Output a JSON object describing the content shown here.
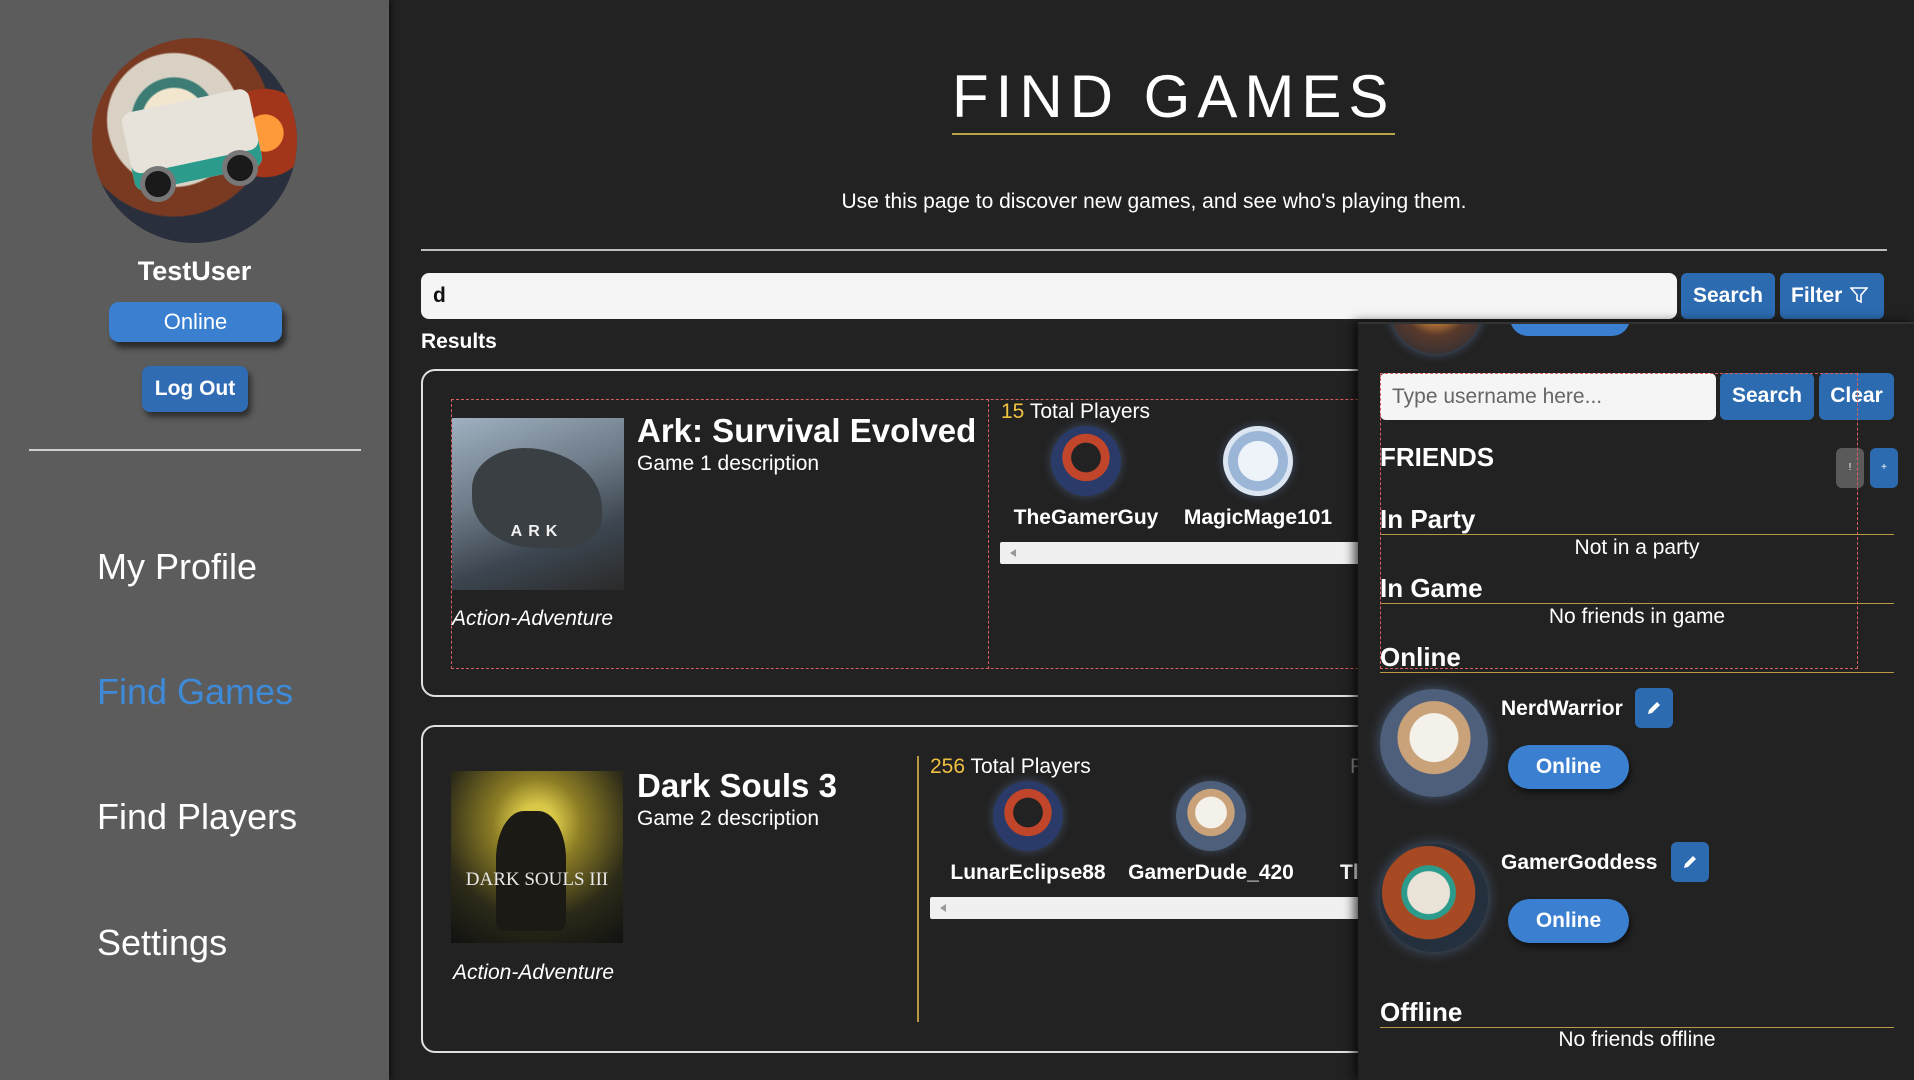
{
  "sidebar": {
    "username": "TestUser",
    "status": "Online",
    "logout_label": "Log Out",
    "nav": [
      {
        "label": "My Profile",
        "active": false
      },
      {
        "label": "Find Games",
        "active": true
      },
      {
        "label": "Find Players",
        "active": false
      },
      {
        "label": "Settings",
        "active": false
      }
    ]
  },
  "main": {
    "title": "FIND GAMES",
    "subtitle": "Use this page to discover new games, and see who's playing them.",
    "search_value": "d",
    "search_label": "Search",
    "filter_label": "Filter",
    "results_label": "Results"
  },
  "games": [
    {
      "title": "Ark: Survival Evolved",
      "description": "Game 1 description",
      "genre": "Action-Adventure",
      "cover_text": "ARK",
      "total_players": "15",
      "total_players_label": "Total Players",
      "players": [
        "TheGamerGuy",
        "MagicMage101"
      ]
    },
    {
      "title": "Dark Souls 3",
      "description": "Game 2 description",
      "genre": "Action-Adventure",
      "cover_text": "DARK SOULS III",
      "total_players": "256",
      "total_players_label": "Total Players",
      "players": [
        "LunarEclipse88",
        "GamerDude_420",
        "Tl"
      ]
    }
  ],
  "friends_panel": {
    "search_placeholder": "Type username here...",
    "search_label": "Search",
    "clear_label": "Clear",
    "heading": "FRIENDS",
    "btn_info": "!",
    "btn_add": "+",
    "sections": {
      "in_party": {
        "title": "In Party",
        "empty": "Not in a party"
      },
      "in_game": {
        "title": "In Game",
        "empty": "No friends in game"
      },
      "online": {
        "title": "Online"
      },
      "offline": {
        "title": "Offline",
        "empty": "No friends offline"
      }
    },
    "online_friends": [
      {
        "name": "NerdWarrior",
        "status": "Online"
      },
      {
        "name": "GamerGoddess",
        "status": "Online"
      }
    ]
  },
  "colors": {
    "accent_blue": "#3a7fd0",
    "nav_active": "#3e8ad8",
    "player_count": "#f0c040",
    "dashed_outline": "#d7605e"
  }
}
